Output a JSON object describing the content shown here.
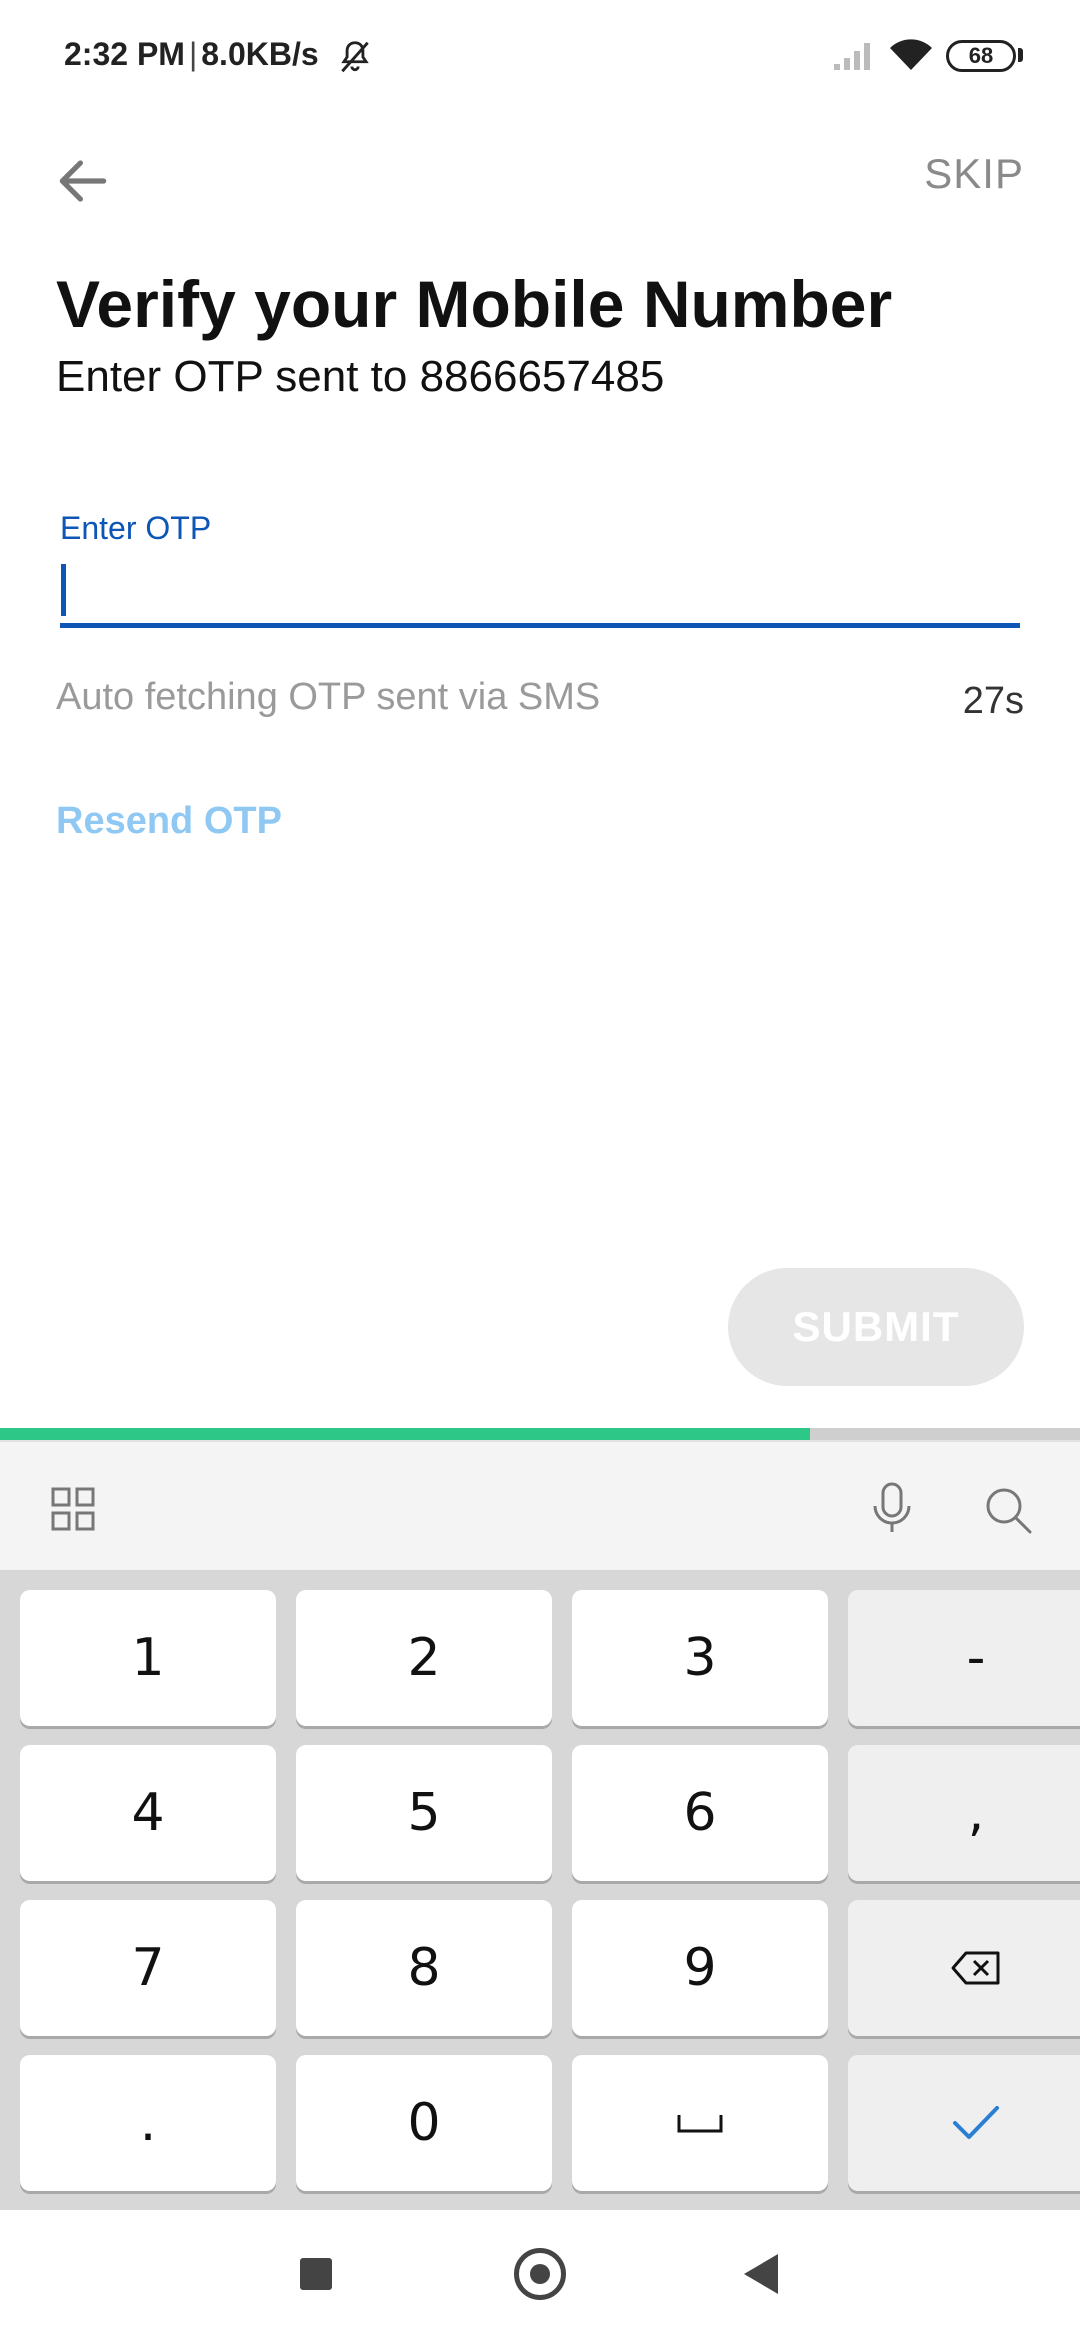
{
  "status_bar": {
    "time": "2:32 PM",
    "separator": "|",
    "speed": "8.0KB/s",
    "battery": "68",
    "icons": [
      "bell-muted-icon",
      "signal-icon",
      "wifi-icon",
      "battery-icon"
    ]
  },
  "header": {
    "back_icon": "arrow-left-icon",
    "skip_label": "SKIP"
  },
  "main": {
    "title": "Verify your Mobile Number",
    "subtitle": "Enter OTP sent to 8866657485",
    "otp_label": "Enter OTP",
    "otp_value": "",
    "auto_fetch_text": "Auto fetching OTP sent via SMS",
    "countdown": "27s",
    "resend_label": "Resend OTP",
    "submit_label": "SUBMIT"
  },
  "progress": {
    "fraction": 0.75
  },
  "keyboard": {
    "toolbar_icons": [
      "grid-icon",
      "mic-icon",
      "search-icon"
    ],
    "keys": [
      {
        "label": "1",
        "name": "key-1"
      },
      {
        "label": "2",
        "name": "key-2"
      },
      {
        "label": "3",
        "name": "key-3"
      },
      {
        "label": "-",
        "name": "key-minus"
      },
      {
        "label": "4",
        "name": "key-4"
      },
      {
        "label": "5",
        "name": "key-5"
      },
      {
        "label": "6",
        "name": "key-6"
      },
      {
        "label": ",",
        "name": "key-comma"
      },
      {
        "label": "7",
        "name": "key-7"
      },
      {
        "label": "8",
        "name": "key-8"
      },
      {
        "label": "9",
        "name": "key-9"
      },
      {
        "label": "",
        "name": "key-backspace",
        "icon": "backspace-icon"
      },
      {
        "label": ".",
        "name": "key-period"
      },
      {
        "label": "0",
        "name": "key-0"
      },
      {
        "label": "",
        "name": "key-space",
        "icon": "space-icon"
      },
      {
        "label": "",
        "name": "key-done",
        "icon": "checkmark-icon"
      }
    ]
  },
  "nav_bar": {
    "icons": [
      "recents-icon",
      "home-icon",
      "back-icon"
    ]
  },
  "colors": {
    "accent_blue": "#0d56b5",
    "link_blue": "#8ec8f3",
    "progress_green": "#2dc887",
    "submit_disabled": "#e6e6e6"
  }
}
